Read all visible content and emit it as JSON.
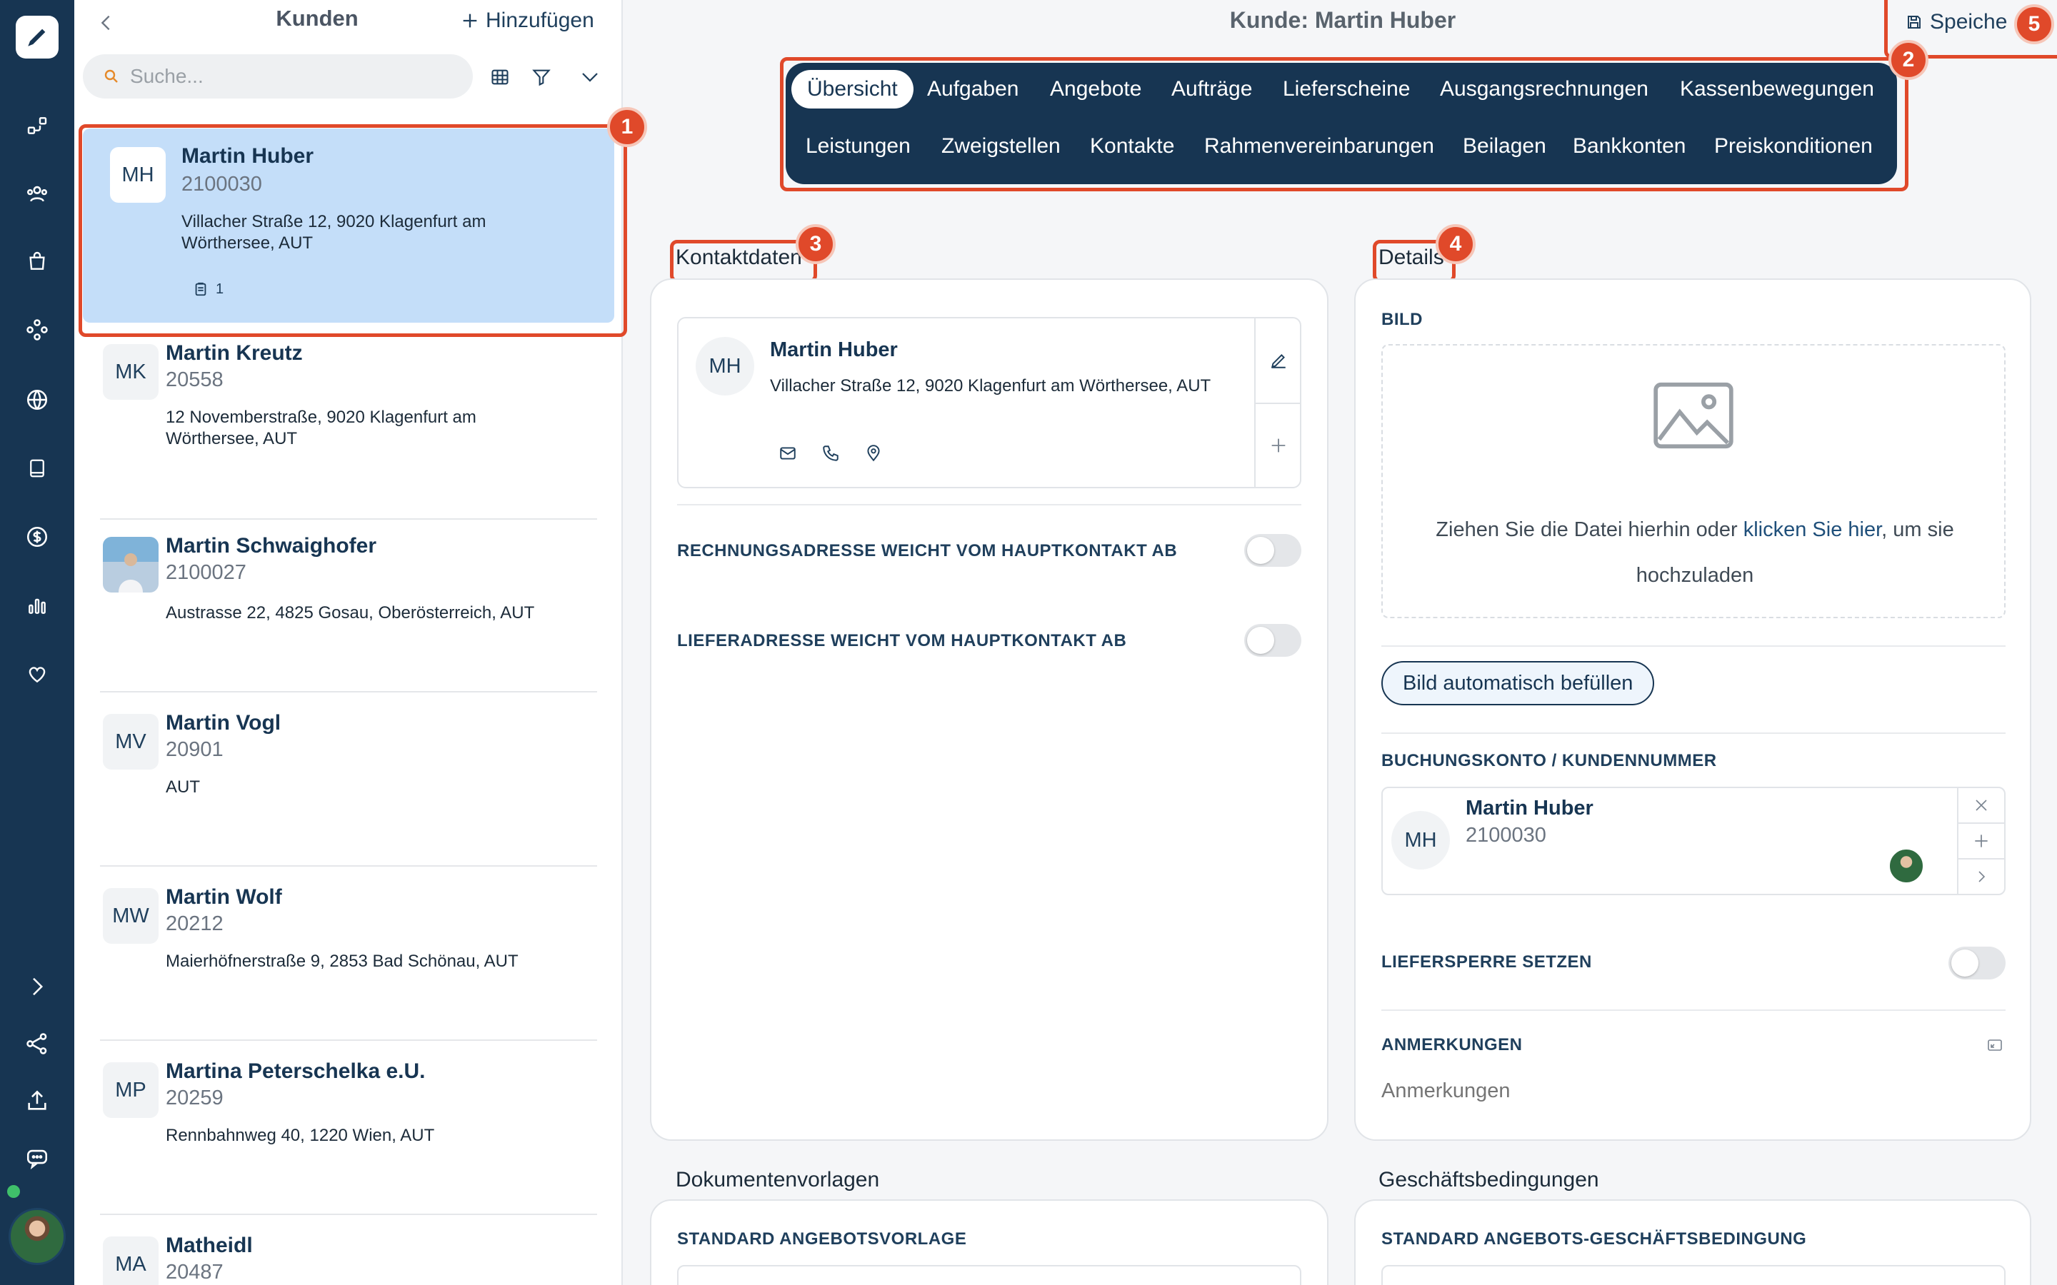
{
  "sidebar": {
    "icons": [
      "pen-icon",
      "flow-icon",
      "users-icon",
      "bag-icon",
      "modules-icon",
      "globe-icon",
      "book-icon",
      "dollar-icon",
      "chart-icon",
      "heart-icon",
      "expand-icon",
      "share-icon",
      "upload-icon",
      "chat-icon"
    ]
  },
  "list": {
    "title": "Kunden",
    "add_label": "Hinzufügen",
    "search_placeholder": "Suche...",
    "customers": [
      {
        "initials": "MH",
        "name": "Martin Huber",
        "number": "2100030",
        "address": "Villacher Straße 12, 9020 Klagenfurt am Wörthersee, AUT",
        "doc_count": "1"
      },
      {
        "initials": "MK",
        "name": "Martin Kreutz",
        "number": "20558",
        "address": "12 Novemberstraße, 9020 Klagenfurt am Wörthersee, AUT"
      },
      {
        "initials": "",
        "name": "Martin Schwaighofer",
        "number": "2100027",
        "address": "Austrasse 22, 4825 Gosau, Oberösterreich, AUT"
      },
      {
        "initials": "MV",
        "name": "Martin Vogl",
        "number": "20901",
        "address": "AUT"
      },
      {
        "initials": "MW",
        "name": "Martin Wolf",
        "number": "20212",
        "address": "Maierhöfnerstraße 9, 2853 Bad Schönau, AUT"
      },
      {
        "initials": "MP",
        "name": "Martina Peterschelka e.U.",
        "number": "20259",
        "address": "Rennbahnweg 40, 1220 Wien, AUT"
      },
      {
        "initials": "MA",
        "name": "Matheidl",
        "number": "20487",
        "address": ""
      }
    ]
  },
  "header": {
    "title": "Kunde: Martin Huber",
    "save_label": "Speiche"
  },
  "tabs": {
    "row1": [
      "Übersicht",
      "Aufgaben",
      "Angebote",
      "Aufträge",
      "Lieferscheine",
      "Ausgangsrechnungen",
      "Kassenbewegungen"
    ],
    "row2": [
      "Leistungen",
      "Zweigstellen",
      "Kontakte",
      "Rahmenvereinbarungen",
      "Beilagen",
      "Bankkonten",
      "Preiskonditionen"
    ]
  },
  "markers": [
    "1",
    "2",
    "3",
    "4",
    "5"
  ],
  "contact": {
    "section_title": "Kontaktdaten",
    "initials": "MH",
    "name": "Martin Huber",
    "address": "Villacher Straße 12, 9020 Klagenfurt am Wörthersee, AUT",
    "billing_toggle_label": "RECHNUNGSADRESSE WEICHT VOM HAUPTKONTAKT AB",
    "delivery_toggle_label": "LIEFERADRESSE WEICHT VOM HAUPTKONTAKT AB"
  },
  "details": {
    "section_title": "Details",
    "image_label": "BILD",
    "upload_text_before": "Ziehen Sie die Datei hierhin oder ",
    "upload_link": "klicken Sie hier",
    "upload_text_after": ", um sie hochzuladen",
    "autofill_button": "Bild automatisch befüllen",
    "account_label": "BUCHUNGSKONTO / KUNDENNUMMER",
    "account_initials": "MH",
    "account_name": "Martin Huber",
    "account_number": "2100030",
    "block_label": "LIEFERSPERRE SETZEN",
    "notes_label": "ANMERKUNGEN",
    "notes_placeholder": "Anmerkungen"
  },
  "bottom": {
    "templates_title": "Dokumentenvorlagen",
    "templates_label": "STANDARD ANGEBOTSVORLAGE",
    "terms_title": "Geschäftsbedingungen",
    "terms_label": "STANDARD ANGEBOTS-GESCHÄFTSBEDINGUNG"
  },
  "colors": {
    "brand_navy": "#173552",
    "selected_row": "#c4def9",
    "marker_red": "#e0492a"
  }
}
